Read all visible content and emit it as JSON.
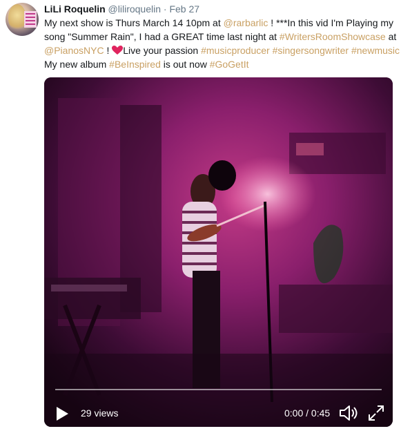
{
  "tweet": {
    "display_name": "LiLi Roquelin",
    "handle": "@liliroquelin",
    "separator": "·",
    "date": "Feb 27",
    "lines": [
      [
        {
          "t": "My next show is Thurs March 14 10pm at ",
          "link": false
        },
        {
          "t": "@rarbarlic",
          "link": true
        },
        {
          "t": " ! ***In this vid I'm Playing my",
          "link": false
        }
      ],
      [
        {
          "t": "song \"Summer Rain\", I had a GREAT time last night at ",
          "link": false
        },
        {
          "t": "#WritersRoomShowcase",
          "link": true
        },
        {
          "t": " at",
          "link": false
        }
      ],
      [
        {
          "t": "@PianosNYC",
          "link": true
        },
        {
          "t": " ! ",
          "link": false
        },
        {
          "heart": true
        },
        {
          "t": "Live your passion ",
          "link": false
        },
        {
          "t": "#musicproducer",
          "link": true
        },
        {
          "t": " ",
          "link": false
        },
        {
          "t": "#singersongwriter",
          "link": true
        },
        {
          "t": " ",
          "link": false
        },
        {
          "t": "#newmusic",
          "link": true
        }
      ],
      [
        {
          "t": "My new album ",
          "link": false
        },
        {
          "t": "#BeInspired",
          "link": true
        },
        {
          "t": " is out now ",
          "link": false
        },
        {
          "t": "#GoGetIt",
          "link": true
        }
      ]
    ]
  },
  "video": {
    "views": "29 views",
    "time": "0:00 / 0:45",
    "progress": 0.0
  },
  "colors": {
    "link": "#c9a063",
    "name": "#14171a",
    "meta": "#657786"
  },
  "icons": {
    "heart": "sparkling-heart-icon",
    "play": "play-icon",
    "volume": "volume-icon",
    "fullscreen": "fullscreen-icon"
  }
}
